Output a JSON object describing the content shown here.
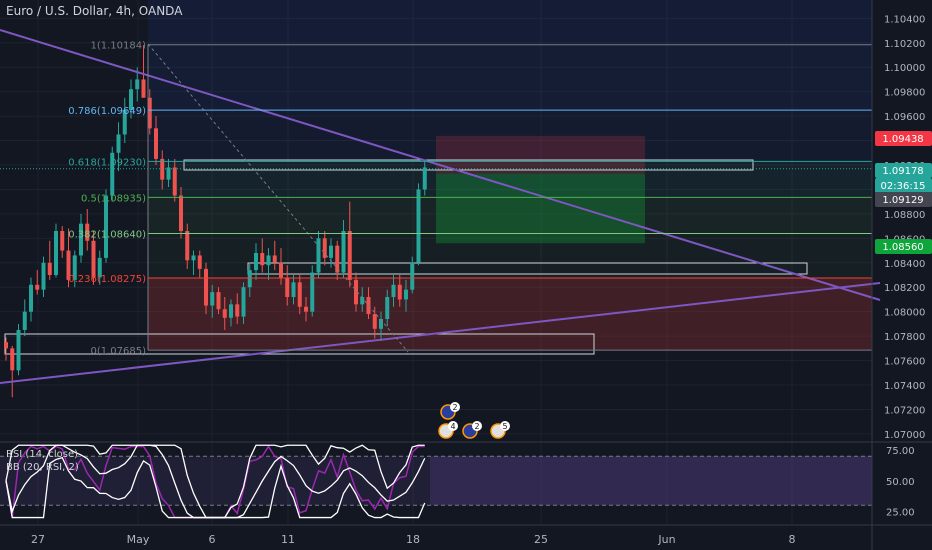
{
  "header": {
    "title": "Euro / U.S. Dollar, 4h, OANDA"
  },
  "indicators": {
    "rsi_label": "RSI (14, close)",
    "bb_label": "BB (20, RSI, 2)"
  },
  "price_axis": {
    "ticks": [
      "1.10400",
      "1.10200",
      "1.10000",
      "1.09800",
      "1.09600",
      "1.09400",
      "1.09200",
      "1.09000",
      "1.08800",
      "1.08600",
      "1.08400",
      "1.08200",
      "1.08000",
      "1.07800",
      "1.07600",
      "1.07400",
      "1.07200",
      "1.07000"
    ],
    "badges": [
      {
        "text": "1.09438",
        "color": "#f23645"
      },
      {
        "text": "1.09178",
        "color": "#26a69a"
      },
      {
        "text": "02:36:15",
        "color": "#26a69a"
      },
      {
        "text": "1.09129",
        "color": "#434651"
      },
      {
        "text": "1.08560",
        "color": "#0ea53a"
      }
    ]
  },
  "rsi_axis": {
    "ticks": [
      "75.00",
      "50.00",
      "25.00"
    ]
  },
  "time_axis": {
    "ticks": [
      "27",
      "May",
      "6",
      "11",
      "18",
      "25",
      "Jun",
      "8"
    ]
  },
  "events": [
    {
      "label": "2",
      "icon": "eu-flag-icon"
    },
    {
      "label": "4",
      "icon": "us-flag-icon"
    },
    {
      "label": "2",
      "icon": "eu-flag-icon"
    },
    {
      "label": "5",
      "icon": "us-flag-icon"
    }
  ],
  "colors": {
    "up": "#26a69a",
    "down": "#ef5350",
    "bg": "#131722",
    "trendline": "#7e57c2",
    "fib_line": "#2962ff"
  },
  "chart_data": {
    "type": "candlestick",
    "symbol": "EURUSD",
    "timeframe": "4h",
    "ylim": [
      1.0695,
      1.1055
    ],
    "fibonacci": [
      {
        "label": "1(1.10184)",
        "level": 1,
        "price": 1.10184,
        "color": "#787b86"
      },
      {
        "label": "0.786(1.09649)",
        "level": 0.786,
        "price": 1.09649,
        "color": "#64b5f6"
      },
      {
        "label": "0.618(1.09230)",
        "level": 0.618,
        "price": 1.0923,
        "color": "#26a69a"
      },
      {
        "label": "0.5(1.08935)",
        "level": 0.5,
        "price": 1.08935,
        "color": "#4caf50"
      },
      {
        "label": "0.382(1.08640)",
        "level": 0.382,
        "price": 1.0864,
        "color": "#81c784"
      },
      {
        "label": "0.236(1.08275)",
        "level": 0.236,
        "price": 1.08275,
        "color": "#f44336"
      },
      {
        "label": "0(1.07685)",
        "level": 0,
        "price": 1.07685,
        "color": "#787b86"
      }
    ],
    "position": {
      "entry": 1.09129,
      "stop": 1.09438,
      "target": 1.0856
    },
    "last_price": 1.09178,
    "countdown": "02:36:15",
    "rsi": {
      "overbought": 70,
      "oversold": 30,
      "last": 70
    },
    "candles": [
      [
        1.0775,
        1.0779,
        1.076,
        1.077
      ],
      [
        1.077,
        1.0772,
        1.073,
        1.0752
      ],
      [
        1.0752,
        1.079,
        1.0748,
        1.0785
      ],
      [
        1.0785,
        1.081,
        1.078,
        1.08
      ],
      [
        1.08,
        1.0828,
        1.0792,
        1.0822
      ],
      [
        1.0822,
        1.0834,
        1.0814,
        1.0818
      ],
      [
        1.0818,
        1.0845,
        1.0812,
        1.084
      ],
      [
        1.084,
        1.0858,
        1.0826,
        1.083
      ],
      [
        1.083,
        1.0872,
        1.0828,
        1.0866
      ],
      [
        1.0866,
        1.087,
        1.0844,
        1.085
      ],
      [
        1.085,
        1.0868,
        1.082,
        1.0826
      ],
      [
        1.0826,
        1.085,
        1.082,
        1.0846
      ],
      [
        1.0846,
        1.088,
        1.084,
        1.0872
      ],
      [
        1.0872,
        1.0884,
        1.085,
        1.0858
      ],
      [
        1.0858,
        1.0866,
        1.0822,
        1.0828
      ],
      [
        1.0828,
        1.085,
        1.0822,
        1.0844
      ],
      [
        1.0844,
        1.09,
        1.084,
        1.0895
      ],
      [
        1.0895,
        1.0935,
        1.089,
        1.093
      ],
      [
        1.093,
        1.0955,
        1.0915,
        1.0945
      ],
      [
        1.0945,
        1.0975,
        1.0938,
        1.0965
      ],
      [
        1.0965,
        1.099,
        1.0958,
        1.0982
      ],
      [
        1.0982,
        1.1,
        1.0972,
        1.099
      ],
      [
        1.099,
        1.1018,
        1.098,
        1.0975
      ],
      [
        1.0975,
        1.0982,
        1.0945,
        1.095
      ],
      [
        1.095,
        1.096,
        1.092,
        1.0925
      ],
      [
        1.0925,
        1.0932,
        1.09,
        1.0908
      ],
      [
        1.0908,
        1.0925,
        1.0902,
        1.0918
      ],
      [
        1.0918,
        1.0925,
        1.089,
        1.0895
      ],
      [
        1.0895,
        1.0902,
        1.086,
        1.0866
      ],
      [
        1.0866,
        1.0872,
        1.0835,
        1.0842
      ],
      [
        1.0842,
        1.085,
        1.083,
        1.0846
      ],
      [
        1.0846,
        1.085,
        1.0828,
        1.0835
      ],
      [
        1.0835,
        1.084,
        1.0798,
        1.0805
      ],
      [
        1.0805,
        1.0822,
        1.0795,
        1.0816
      ],
      [
        1.0816,
        1.082,
        1.0798,
        1.0802
      ],
      [
        1.0802,
        1.0812,
        1.0785,
        1.0795
      ],
      [
        1.0795,
        1.081,
        1.0788,
        1.0806
      ],
      [
        1.0806,
        1.0815,
        1.079,
        1.0796
      ],
      [
        1.0796,
        1.0824,
        1.079,
        1.082
      ],
      [
        1.082,
        1.084,
        1.0812,
        1.0834
      ],
      [
        1.0834,
        1.0856,
        1.0826,
        1.0848
      ],
      [
        1.0848,
        1.086,
        1.0832,
        1.0838
      ],
      [
        1.0838,
        1.0852,
        1.0826,
        1.0846
      ],
      [
        1.0846,
        1.0858,
        1.0834,
        1.084
      ],
      [
        1.084,
        1.0852,
        1.0822,
        1.0828
      ],
      [
        1.0828,
        1.0838,
        1.0805,
        1.0812
      ],
      [
        1.0812,
        1.083,
        1.0806,
        1.0824
      ],
      [
        1.0824,
        1.083,
        1.0798,
        1.0804
      ],
      [
        1.0804,
        1.0812,
        1.0792,
        1.08
      ],
      [
        1.08,
        1.0838,
        1.0796,
        1.0832
      ],
      [
        1.0832,
        1.0866,
        1.0828,
        1.086
      ],
      [
        1.086,
        1.0866,
        1.0838,
        1.0844
      ],
      [
        1.0844,
        1.086,
        1.0836,
        1.0854
      ],
      [
        1.0854,
        1.0858,
        1.0826,
        1.0832
      ],
      [
        1.0832,
        1.0875,
        1.0828,
        1.0866
      ],
      [
        1.0866,
        1.089,
        1.082,
        1.0826
      ],
      [
        1.0826,
        1.0832,
        1.08,
        1.0806
      ],
      [
        1.0806,
        1.082,
        1.08,
        1.0812
      ],
      [
        1.0812,
        1.082,
        1.0794,
        1.0798
      ],
      [
        1.0798,
        1.0804,
        1.0778,
        1.0786
      ],
      [
        1.0786,
        1.08,
        1.0776,
        1.0794
      ],
      [
        1.0794,
        1.0818,
        1.0788,
        1.0812
      ],
      [
        1.0812,
        1.083,
        1.0804,
        1.0822
      ],
      [
        1.0822,
        1.083,
        1.0804,
        1.081
      ],
      [
        1.081,
        1.0826,
        1.08,
        1.0818
      ],
      [
        1.0818,
        1.0845,
        1.0815,
        1.084
      ],
      [
        1.084,
        1.0905,
        1.0838,
        1.09
      ],
      [
        1.09,
        1.0924,
        1.0895,
        1.0918
      ]
    ]
  }
}
